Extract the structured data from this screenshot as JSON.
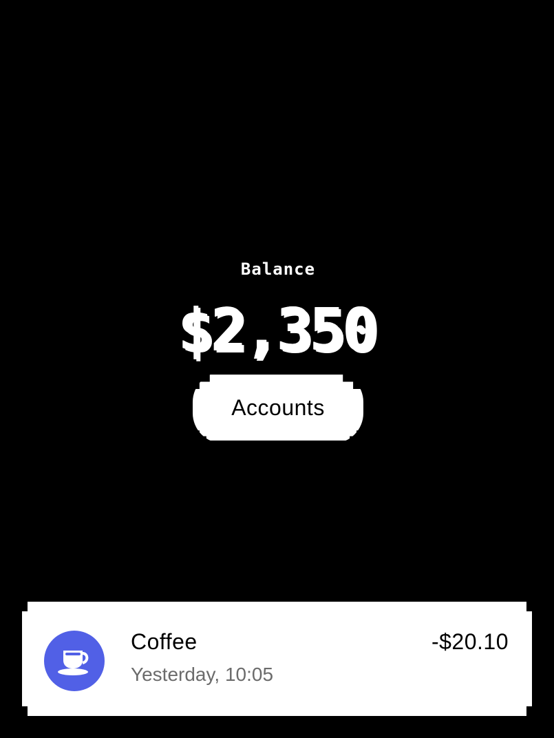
{
  "balance": {
    "label": "Balance",
    "amount": "$2,350"
  },
  "actions": {
    "accounts_label": "Accounts"
  },
  "transaction": {
    "title": "Coffee",
    "subtitle": "Yesterday, 10:05",
    "amount": "-$20.10",
    "icon": "coffee-cup-icon",
    "icon_color": "#5160E6"
  },
  "colors": {
    "background": "#000000",
    "foreground": "#FFFFFF",
    "accent": "#5160E6",
    "muted_text": "#6B6B6B"
  }
}
